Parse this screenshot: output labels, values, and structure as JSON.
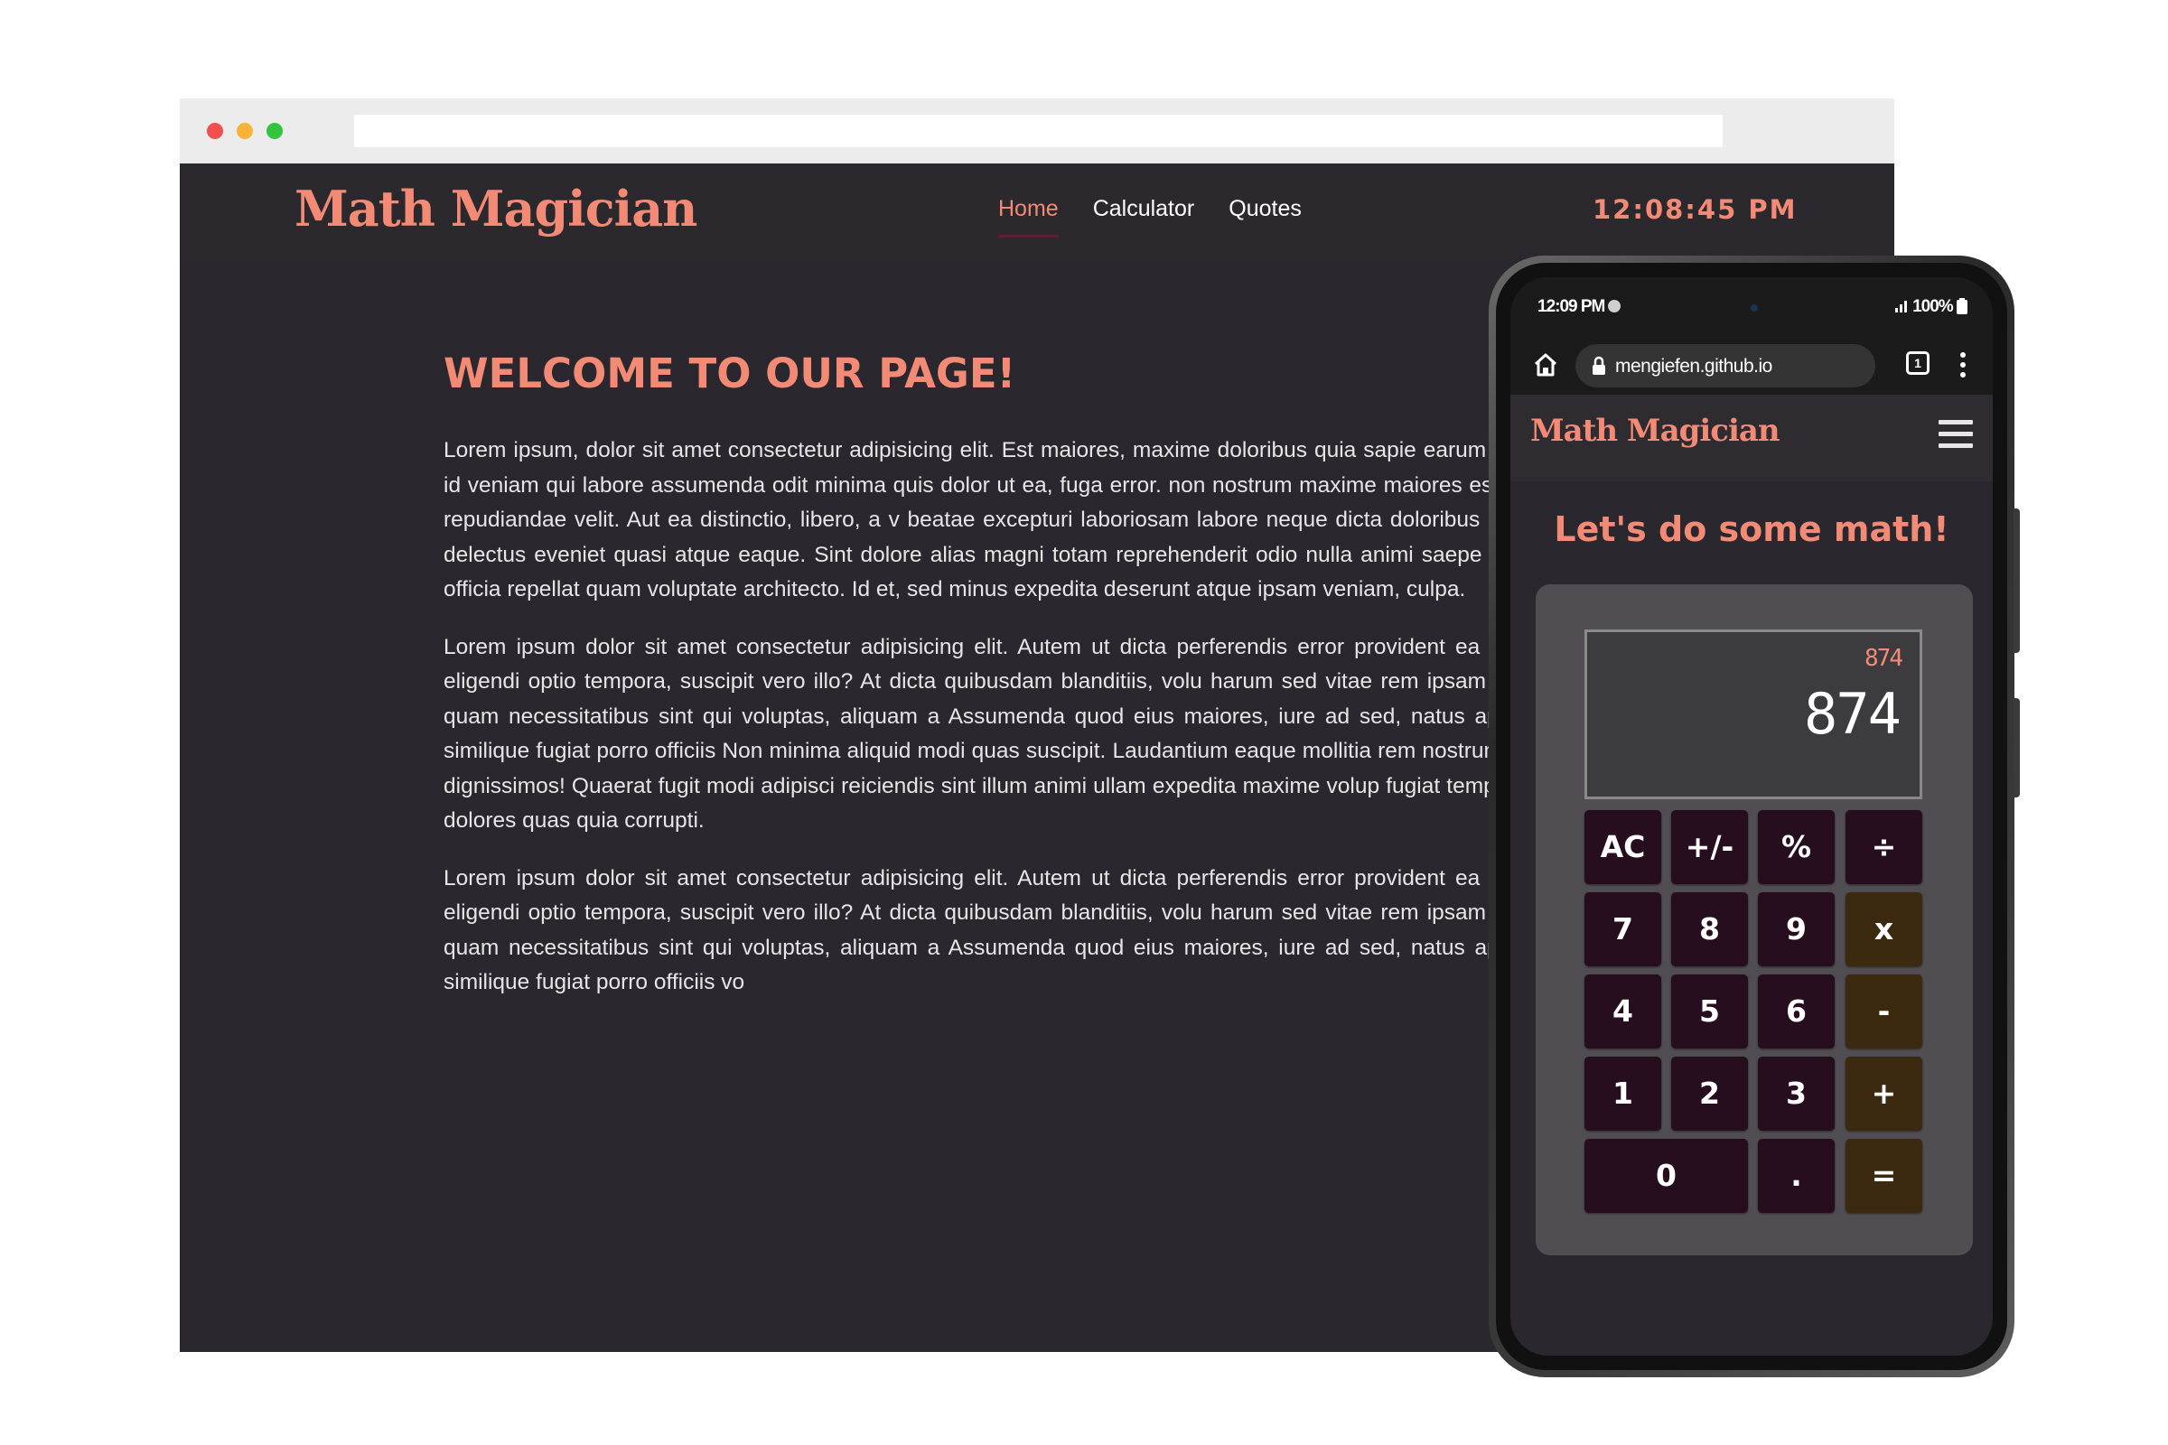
{
  "desktop": {
    "logo": "Math Magician",
    "nav": [
      {
        "label": "Home",
        "active": true
      },
      {
        "label": "Calculator",
        "active": false
      },
      {
        "label": "Quotes",
        "active": false
      }
    ],
    "clock": "12:08:45 PM",
    "heading": "WELCOME TO OUR PAGE!",
    "paragraphs": [
      "Lorem ipsum, dolor sit amet consectetur adipisicing elit. Est maiores, maxime doloribus quia sapie earum similique ex aliquid id veniam qui labore assumenda odit minima quis dolor ut ea, fuga error. non nostrum maxime maiores est animi recusandae repudiandae velit. Aut ea distinctio, libero, a v beatae excepturi laboriosam labore neque dicta doloribus omnis nemo non at delectus eveniet quasi atque eaque. Sint dolore alias magni totam reprehenderit odio nulla animi saepe iste numquam, obc officia repellat quam voluptate architecto. Id et, sed minus expedita deserunt atque ipsam veniam, culpa.",
      "Lorem ipsum dolor sit amet consectetur adipisicing elit. Autem ut dicta perferendis error provident ea nisi est voluptatum eligendi optio tempora, suscipit vero illo? At dicta quibusdam blanditiis, volu harum sed vitae rem ipsam repudiandae facilis quam necessitatibus sint qui voluptas, aliquam a Assumenda quod eius maiores, iure ad sed, natus aperiam ex expedita similique fugiat porro officiis Non minima aliquid modi quas suscipit. Laudantium eaque mollitia rem nostrum voluptatibus expe dignissimos! Quaerat fugit modi adipisci reiciendis sint illum animi ullam expedita maxime volup fugiat tempora harum ut quasi dolores quas quia corrupti.",
      "Lorem ipsum dolor sit amet consectetur adipisicing elit. Autem ut dicta perferendis error provident ea nisi est voluptatum eligendi optio tempora, suscipit vero illo? At dicta quibusdam blanditiis, volu harum sed vitae rem ipsam repudiandae facilis quam necessitatibus sint qui voluptas, aliquam a Assumenda quod eius maiores, iure ad sed, natus aperiam ex expedita similique fugiat porro officiis vo"
    ]
  },
  "phone": {
    "status_time": "12:09 PM",
    "status_right": "⋮▐ 100%▮",
    "url": "mengiefen.github.io",
    "tabs_count": "1",
    "logo": "Math Magician",
    "title": "Let's do some math!",
    "display_prev": "874",
    "display_current": "874",
    "keys": [
      "AC",
      "+/-",
      "%",
      "÷",
      "7",
      "8",
      "9",
      "x",
      "4",
      "5",
      "6",
      "-",
      "1",
      "2",
      "3",
      "+",
      "0",
      ".",
      "="
    ]
  },
  "colors": {
    "accent": "#f28a75",
    "page_bg": "#2a282e",
    "key_bg": "#260e1e",
    "operator_key_bg": "#3b2a10"
  },
  "icons": [
    "home-icon",
    "lock-icon",
    "tabs-icon",
    "menu-dots-icon",
    "hamburger-icon"
  ]
}
